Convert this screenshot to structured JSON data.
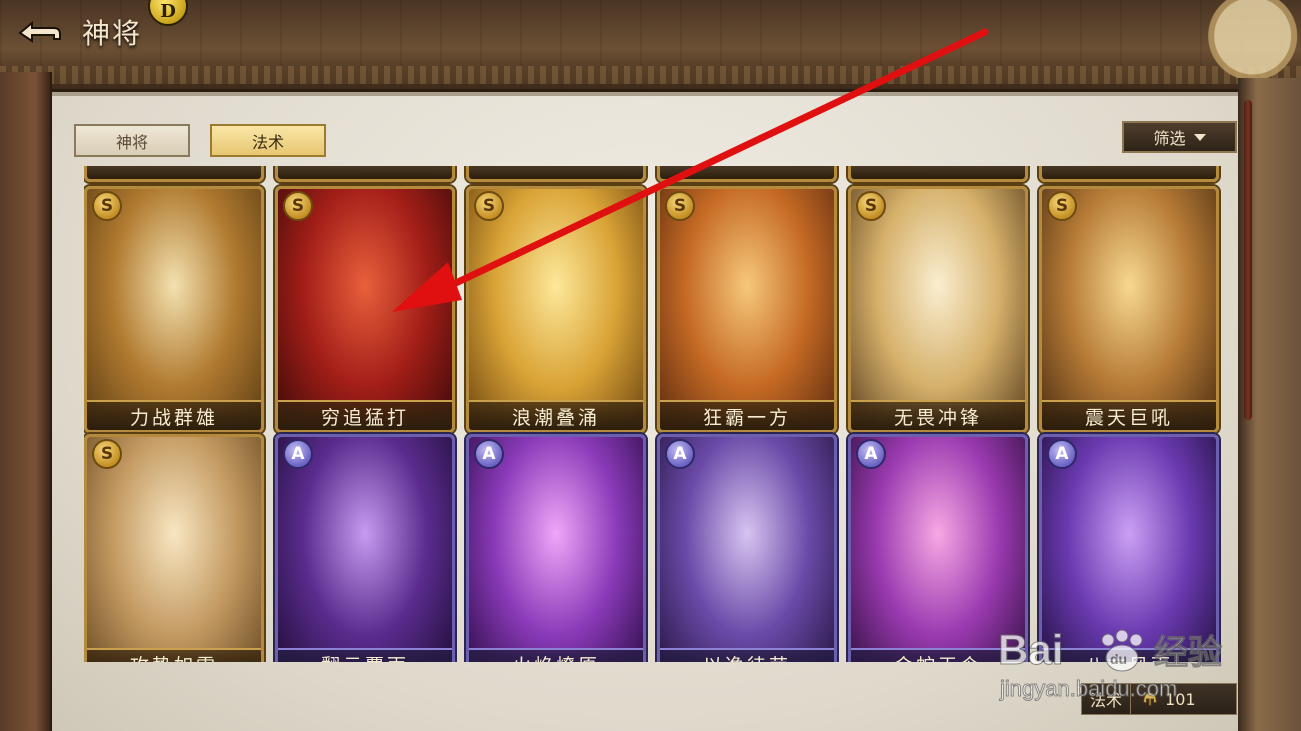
{
  "header": {
    "title": "神将"
  },
  "tabs": [
    {
      "label": "神将",
      "active": false
    },
    {
      "label": "法术",
      "active": true
    }
  ],
  "filter": {
    "label": "筛选"
  },
  "cards_row1": [
    {
      "name": "力战群雄",
      "grade": "S",
      "art": [
        "#f3e1b0",
        "#b07a30",
        "#5c3d14"
      ]
    },
    {
      "name": "穷追猛打",
      "grade": "S",
      "art": [
        "#e8603c",
        "#a21e18",
        "#3a0a08"
      ]
    },
    {
      "name": "浪潮叠涌",
      "grade": "S",
      "art": [
        "#fde89a",
        "#d9a336",
        "#6d4510"
      ]
    },
    {
      "name": "狂霸一方",
      "grade": "S",
      "art": [
        "#f6c87a",
        "#c56a24",
        "#5a2a10"
      ]
    },
    {
      "name": "无畏冲锋",
      "grade": "S",
      "art": [
        "#faeed0",
        "#d5b06a",
        "#5c4020"
      ]
    },
    {
      "name": "震天巨吼",
      "grade": "S",
      "art": [
        "#f7d890",
        "#b57a36",
        "#4c2e12"
      ]
    }
  ],
  "cards_row2": [
    {
      "name": "攻势如雷",
      "grade": "S",
      "art": [
        "#f8e6c2",
        "#c39a62",
        "#6a4a22"
      ]
    },
    {
      "name": "翻云覆雨",
      "grade": "A",
      "art": [
        "#c69bf0",
        "#5a2c8e",
        "#1e0c34"
      ]
    },
    {
      "name": "火焰燎原",
      "grade": "A",
      "art": [
        "#f0a6f8",
        "#8a3ab8",
        "#2a0c44"
      ]
    },
    {
      "name": "以逸待劳",
      "grade": "A",
      "art": [
        "#d7c4f0",
        "#6a4aa8",
        "#24143e"
      ]
    },
    {
      "name": "金蛇王令",
      "grade": "A",
      "art": [
        "#f8a8e4",
        "#9a3ab0",
        "#2e0e3c"
      ]
    },
    {
      "name": "八方风雨",
      "grade": "A",
      "art": [
        "#caa0f4",
        "#6a3ab0",
        "#1e0e3a"
      ]
    }
  ],
  "counter": {
    "label": "法术",
    "value": "101"
  },
  "watermark": {
    "brand": "Bai",
    "paw": "du",
    "site": "经验",
    "url": "jingyan.baidu.com"
  },
  "annotation_arrow_color": "#e01010"
}
